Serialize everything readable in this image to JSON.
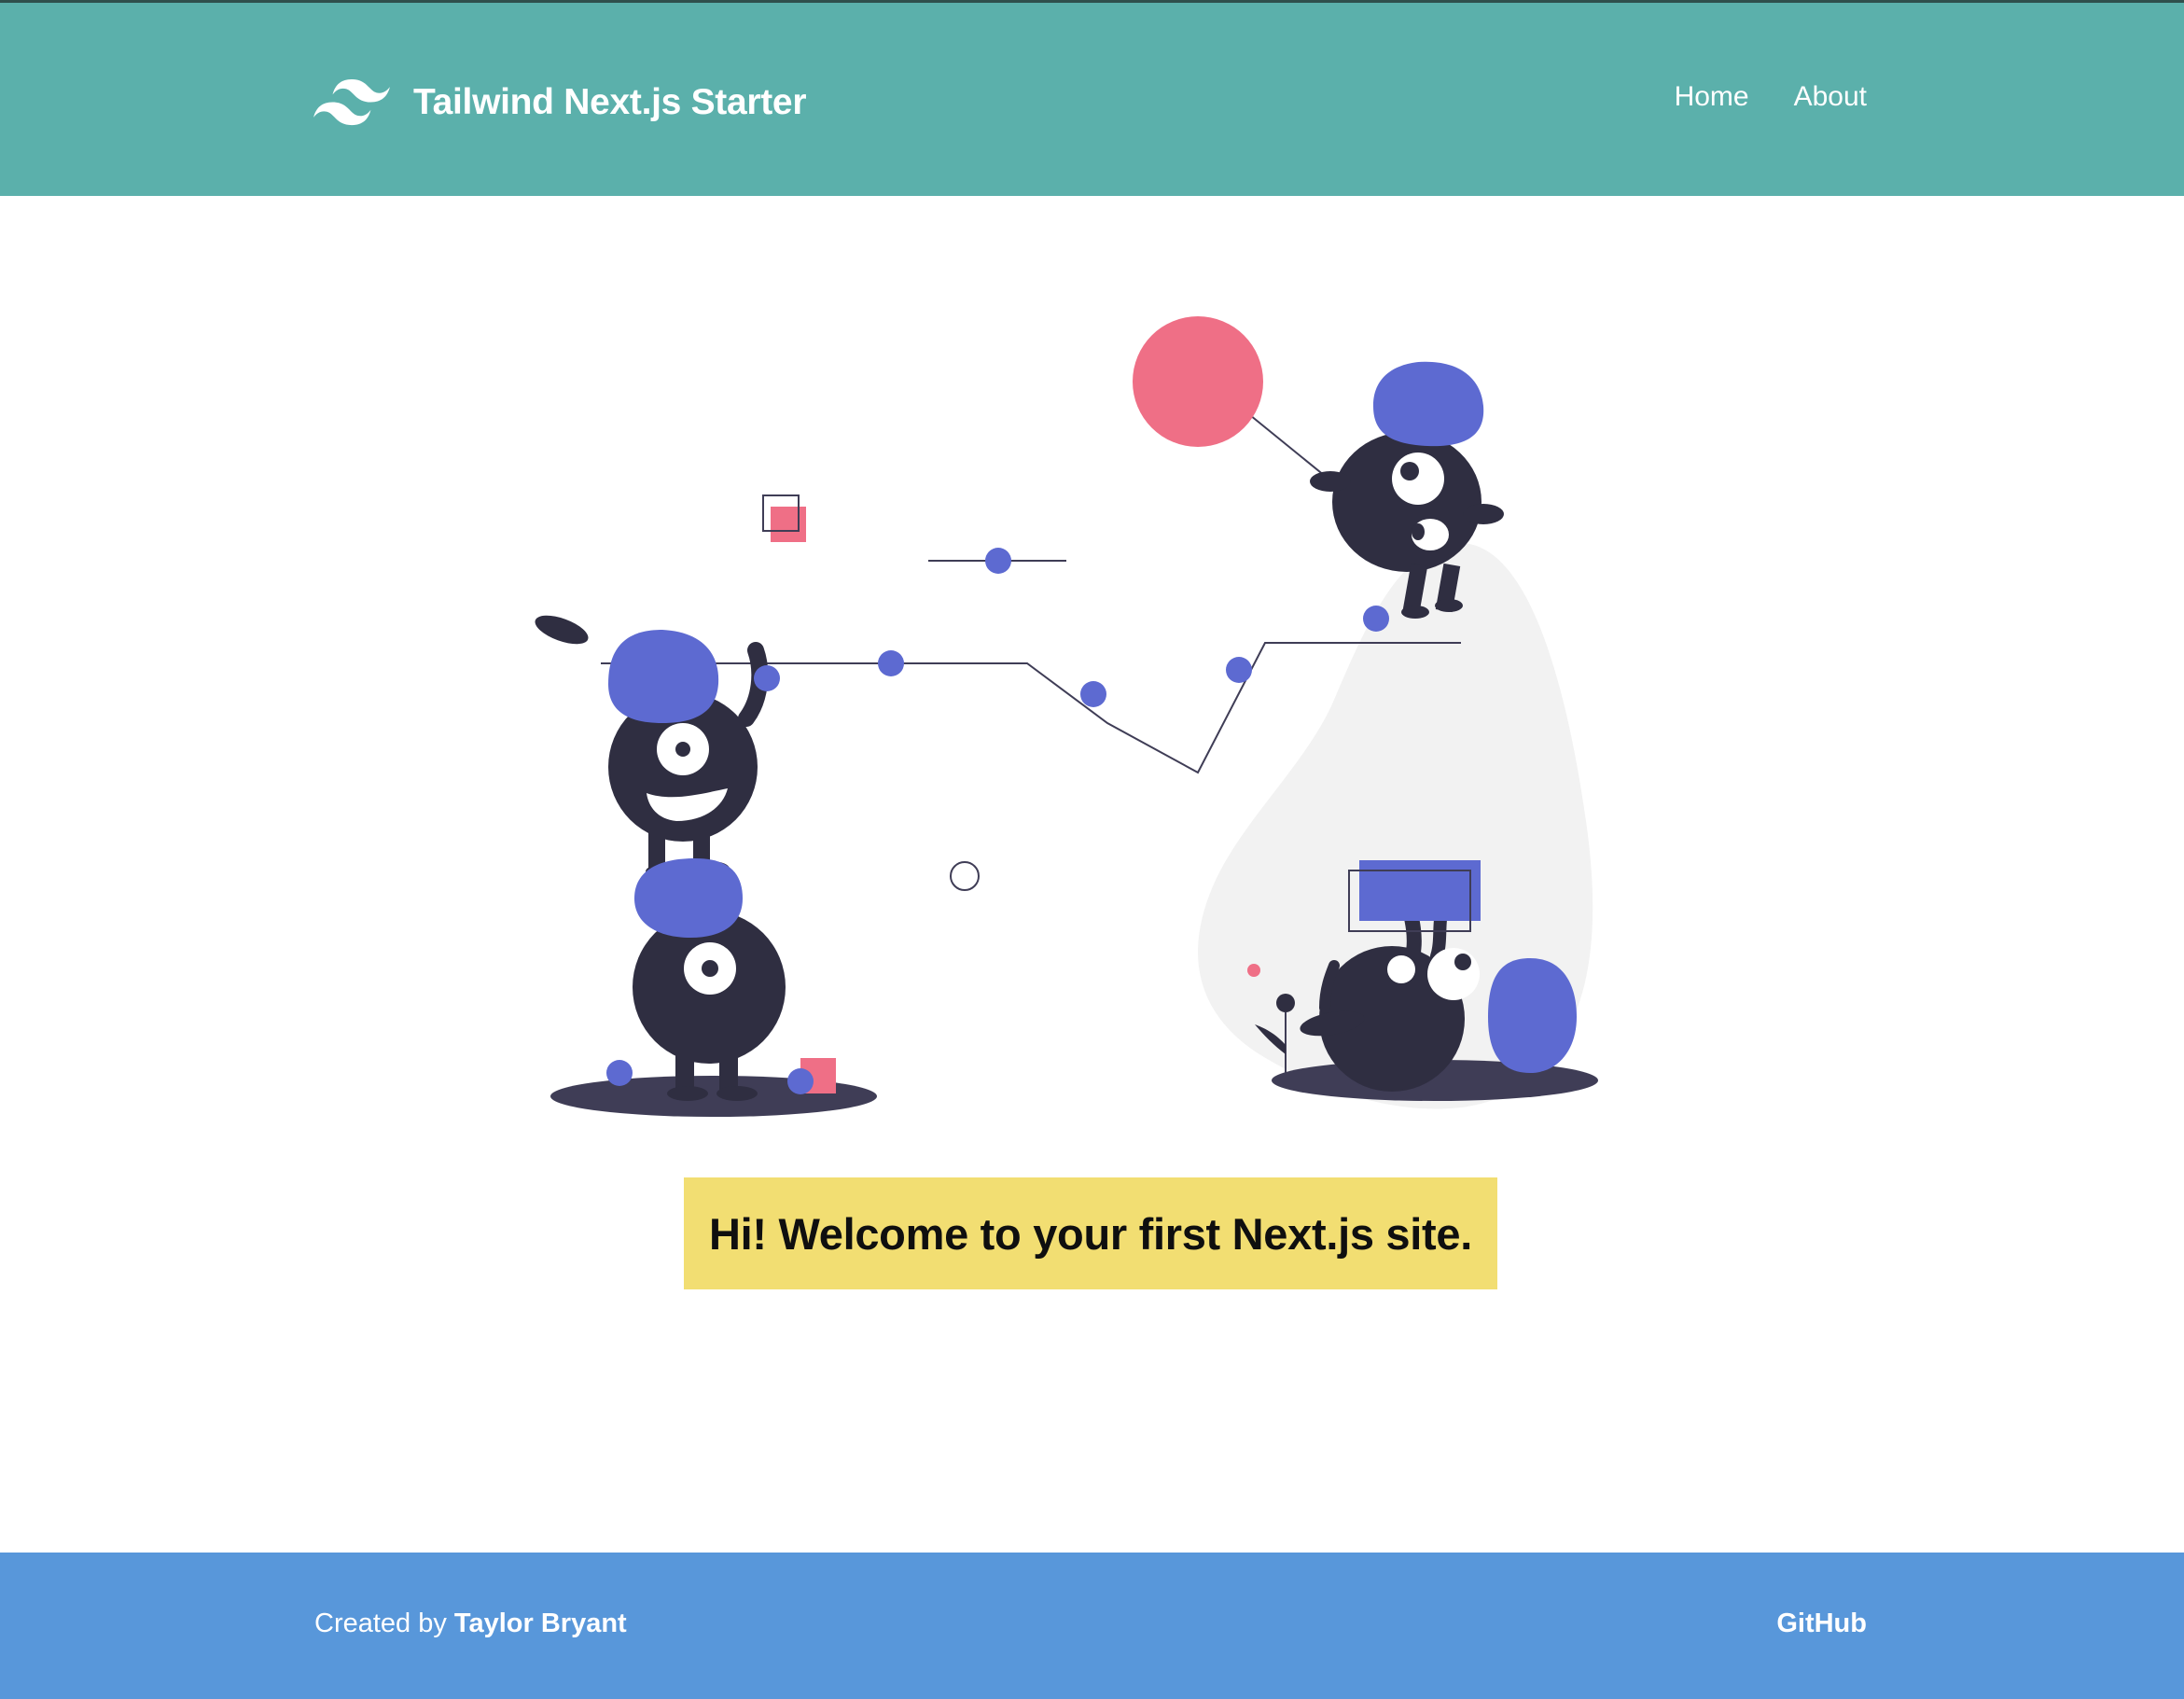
{
  "header": {
    "brand_title": "Tailwind Next.js Starter",
    "nav": {
      "home_label": "Home",
      "about_label": "About"
    },
    "background_color": "#5bb0ab"
  },
  "main": {
    "illustration_icon": "monsters-playing-illustration",
    "welcome_text": "Hi! Welcome to your first Next.js site.",
    "welcome_background": "#f2de72"
  },
  "footer": {
    "created_by_prefix": "Created by",
    "author_name": "Taylor Bryant",
    "github_label": "GitHub",
    "background_color": "#5897da"
  },
  "icons": {
    "brand_logo": "tailwind-logo-icon"
  }
}
